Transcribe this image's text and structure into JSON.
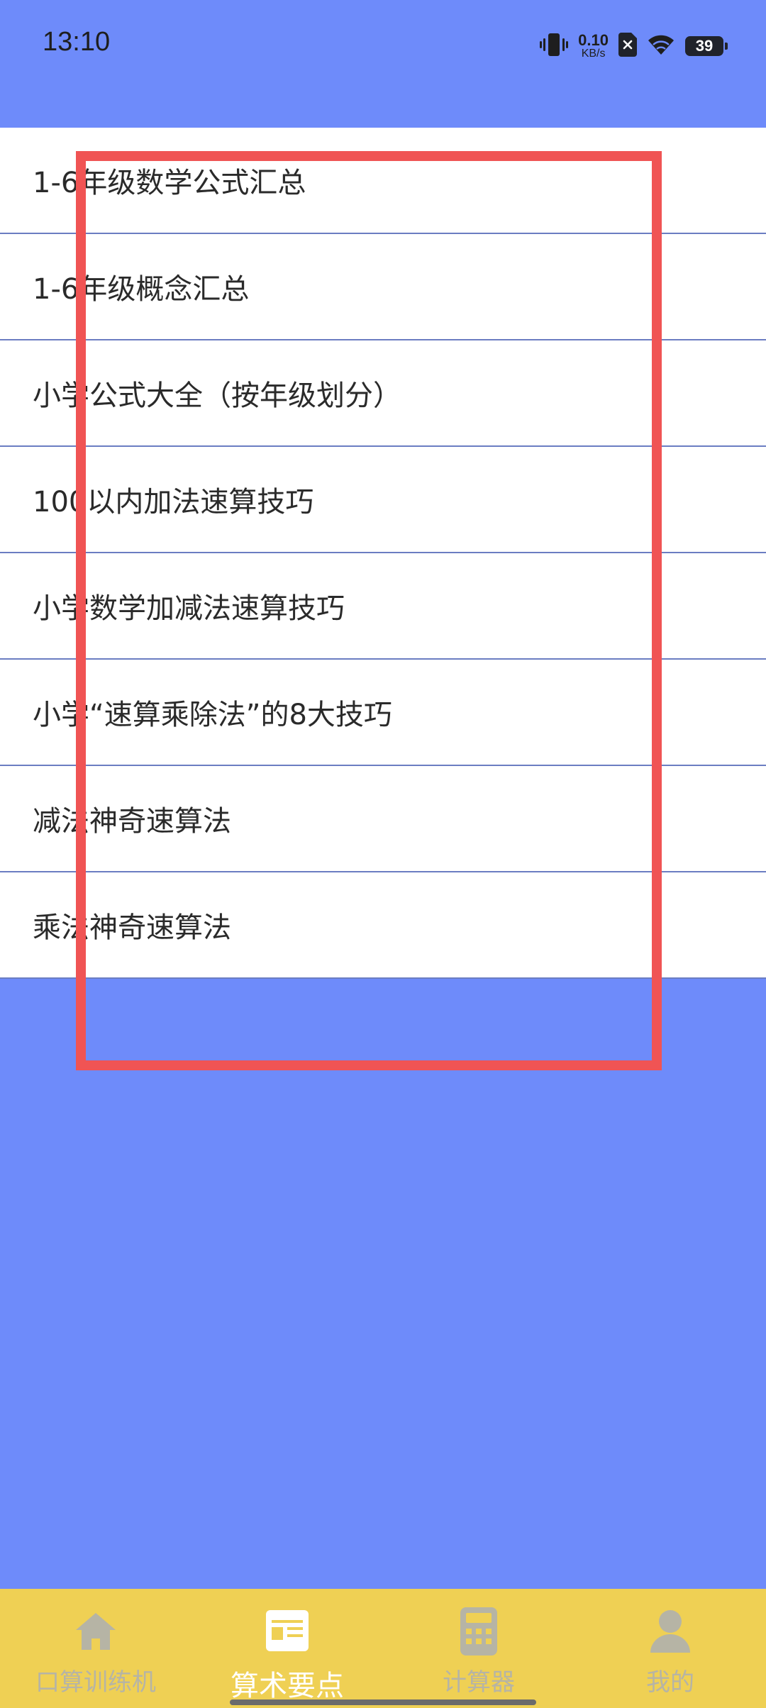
{
  "status_bar": {
    "time": "13:10",
    "net_speed_value": "0.10",
    "net_speed_unit": "KB/s",
    "battery_level": "39"
  },
  "articles": [
    {
      "title": "1-6年级数学公式汇总"
    },
    {
      "title": "1-6年级概念汇总"
    },
    {
      "title": "小学公式大全（按年级划分）"
    },
    {
      "title": "100以内加法速算技巧"
    },
    {
      "title": "小学数学加减法速算技巧"
    },
    {
      "title": "小学“速算乘除法”的8大技巧"
    },
    {
      "title": "减法神奇速算法"
    },
    {
      "title": "乘法神奇速算法"
    }
  ],
  "bottom_nav": {
    "items": [
      {
        "label": "口算训练机",
        "icon": "home-icon",
        "active": false
      },
      {
        "label": "算术要点",
        "icon": "article-icon",
        "active": true
      },
      {
        "label": "计算器",
        "icon": "calculator-icon",
        "active": false
      },
      {
        "label": "我的",
        "icon": "profile-icon",
        "active": false
      }
    ]
  },
  "colors": {
    "background": "#6e8bfa",
    "list_background": "#ffffff",
    "divider": "#6b7dc2",
    "highlight": "#f05454",
    "nav_background": "#efd054",
    "nav_active": "#ffffff",
    "nav_inactive": "#b6b4a5"
  }
}
